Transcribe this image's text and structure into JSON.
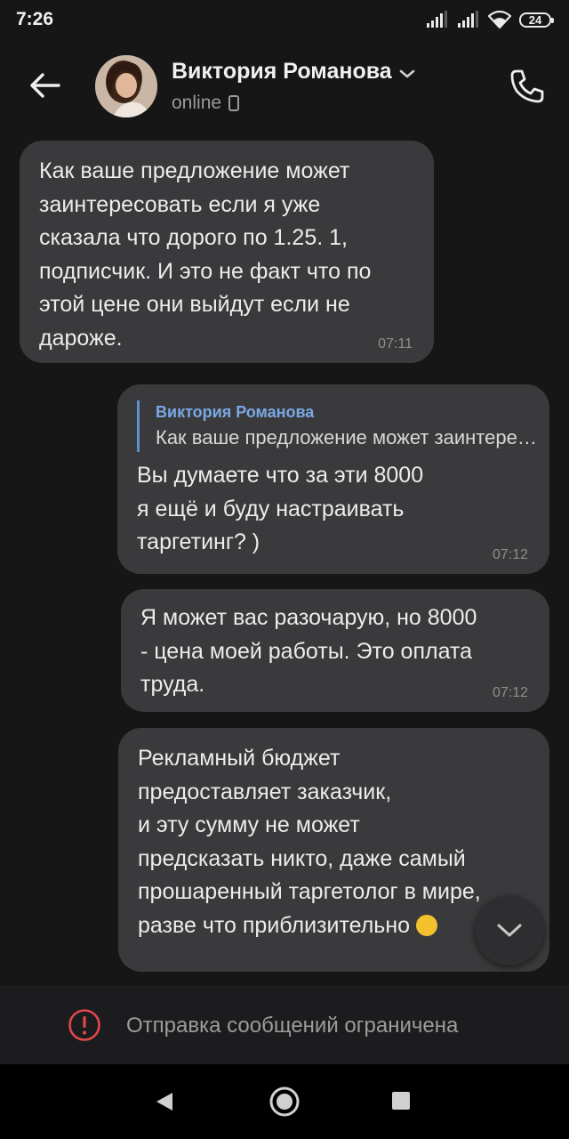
{
  "status_bar": {
    "time": "7:26",
    "battery": "24"
  },
  "header": {
    "contact_name": "Виктория Романова",
    "status": "online"
  },
  "messages": [
    {
      "direction": "incoming",
      "text": "Как ваше предложение может\nзаинтересовать если я уже\nсказала что дорого по 1.25. 1,\nподписчик. И это не факт что по\nэтой цене они выйдут если не\nдароже.",
      "time": "07:11"
    },
    {
      "direction": "outgoing",
      "reply_author": "Виктория Романова",
      "reply_text": "Как ваше предложение может заинтересовать",
      "text": "Вы думаете что за эти 8000\nя ещё и буду настраивать\nтаргетинг? )",
      "time": "07:12"
    },
    {
      "direction": "outgoing",
      "text": "Я может вас разочарую,  но 8000\n- цена моей работы. Это оплата\nтруда.",
      "time": "07:12"
    },
    {
      "direction": "outgoing",
      "text": "Рекламный бюджет\nпредоставляет заказчик,\nи эту сумму не может\nпредсказать никто, даже самый\nпрошаренный таргетолог в мире,\nразве что приблизительно"
    }
  ],
  "restriction": {
    "text": "Отправка сообщений ограничена"
  },
  "colors": {
    "background": "#161616",
    "bubble": "#3a3a3c",
    "reply_accent": "#7aa8e4",
    "warning": "#e0474c"
  }
}
